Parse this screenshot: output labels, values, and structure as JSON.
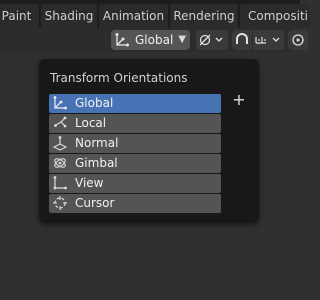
{
  "workspace_tabs": [
    "Paint",
    "Shading",
    "Animation",
    "Rendering",
    "Compositi"
  ],
  "header": {
    "orientation_value": "Global",
    "orientation_icon": "global-axis-icon",
    "pivot_icon": "pivot-point-icon",
    "snap_icon": "snap-magnet-icon",
    "snap_mode_icon": "snap-increment-icon",
    "proportional_icon": "proportional-edit-icon"
  },
  "popup": {
    "title": "Transform Orientations",
    "add_label": "+",
    "items": [
      {
        "label": "Global",
        "icon": "global-axis-icon",
        "active": true
      },
      {
        "label": "Local",
        "icon": "local-axis-icon",
        "active": false
      },
      {
        "label": "Normal",
        "icon": "normal-icon",
        "active": false
      },
      {
        "label": "Gimbal",
        "icon": "gimbal-icon",
        "active": false
      },
      {
        "label": "View",
        "icon": "view-axis-icon",
        "active": false
      },
      {
        "label": "Cursor",
        "icon": "cursor-icon",
        "active": false
      }
    ]
  },
  "colors": {
    "active_row": "#4772b3",
    "row": "#545454",
    "popup_bg": "#181818",
    "viewport_bg": "#303030"
  }
}
